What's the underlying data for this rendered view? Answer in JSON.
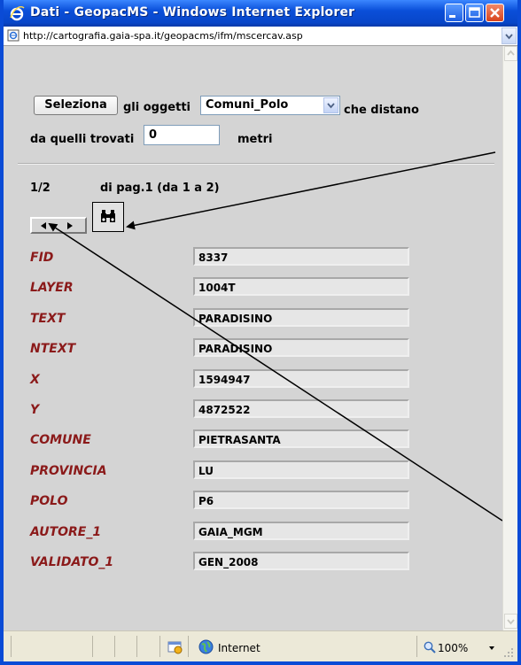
{
  "window": {
    "title": "Dati - GeopacMS - Windows Internet Explorer",
    "url": "http://cartografia.gaia-spa.it/geopacms/ifm/mscercav.asp"
  },
  "toolbar": {
    "select_button": "Seleziona",
    "text_objects": "gli oggetti",
    "layer_select_value": "Comuni_Polo",
    "text_distance": "che distano",
    "text_from_found": "da quelli trovati",
    "distance_value": "0",
    "unit": "metri"
  },
  "pagination": {
    "record": "1/2",
    "page_info": "di pag.1  (da 1 a 2)"
  },
  "fields": [
    {
      "label": "FID",
      "value": "8337"
    },
    {
      "label": "LAYER",
      "value": "1004T"
    },
    {
      "label": "TEXT",
      "value": "PARADISINO"
    },
    {
      "label": "NTEXT",
      "value": "PARADISINO"
    },
    {
      "label": "X",
      "value": "1594947"
    },
    {
      "label": "Y",
      "value": "4872522"
    },
    {
      "label": "COMUNE",
      "value": "PIETRASANTA"
    },
    {
      "label": "PROVINCIA",
      "value": "LU"
    },
    {
      "label": "POLO",
      "value": "P6"
    },
    {
      "label": "AUTORE_1",
      "value": "GAIA_MGM"
    },
    {
      "label": "VALIDATO_1",
      "value": "GEN_2008"
    }
  ],
  "statusbar": {
    "zone": "Internet",
    "zoom": "100%"
  },
  "icons": {
    "browser": "ie-icon",
    "page": "page-icon",
    "find": "binoculars-icon",
    "prev": "triangle-left-icon",
    "next": "triangle-right-icon",
    "globe": "globe-icon",
    "zoom": "magnifier-icon"
  }
}
